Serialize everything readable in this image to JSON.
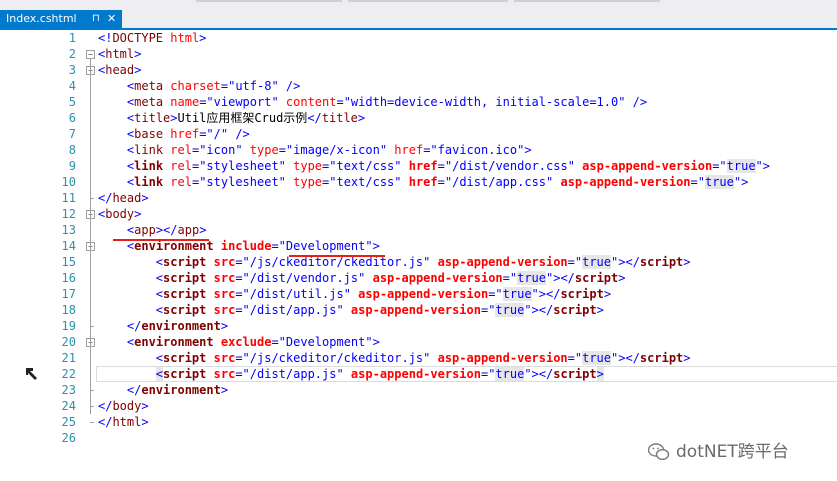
{
  "tab": {
    "title": "Index.cshtml",
    "pin": "⊓",
    "close": "✕"
  },
  "lines": [
    {
      "n": "1",
      "segs": [
        [
          "p",
          "<!"
        ],
        [
          "t",
          "DOCTYPE"
        ],
        [
          "c",
          " "
        ],
        [
          "a",
          "html"
        ],
        [
          "p",
          ">"
        ]
      ]
    },
    {
      "n": "2",
      "segs": [
        [
          "p",
          "<"
        ],
        [
          "t",
          "html"
        ],
        [
          "p",
          ">"
        ]
      ]
    },
    {
      "n": "3",
      "segs": [
        [
          "p",
          "<"
        ],
        [
          "t",
          "head"
        ],
        [
          "p",
          ">"
        ]
      ]
    },
    {
      "n": "4",
      "segs": [
        [
          "c",
          "    "
        ],
        [
          "p",
          "<"
        ],
        [
          "t",
          "meta"
        ],
        [
          "c",
          " "
        ],
        [
          "a",
          "charset"
        ],
        [
          "p",
          "=\""
        ],
        [
          "v",
          "utf-8"
        ],
        [
          "p",
          "\" />"
        ]
      ]
    },
    {
      "n": "5",
      "segs": [
        [
          "c",
          "    "
        ],
        [
          "p",
          "<"
        ],
        [
          "t",
          "meta"
        ],
        [
          "c",
          " "
        ],
        [
          "a",
          "name"
        ],
        [
          "p",
          "=\""
        ],
        [
          "v",
          "viewport"
        ],
        [
          "p",
          "\" "
        ],
        [
          "a",
          "content"
        ],
        [
          "p",
          "=\""
        ],
        [
          "v",
          "width=device-width, initial-scale=1.0"
        ],
        [
          "p",
          "\" />"
        ]
      ]
    },
    {
      "n": "6",
      "segs": [
        [
          "c",
          "    "
        ],
        [
          "p",
          "<"
        ],
        [
          "t",
          "title"
        ],
        [
          "p",
          ">"
        ],
        [
          "c",
          "Util应用框架Crud示例"
        ],
        [
          "p",
          "</"
        ],
        [
          "t",
          "title"
        ],
        [
          "p",
          ">"
        ]
      ]
    },
    {
      "n": "7",
      "segs": [
        [
          "c",
          "    "
        ],
        [
          "p",
          "<"
        ],
        [
          "t",
          "base"
        ],
        [
          "c",
          " "
        ],
        [
          "a",
          "href"
        ],
        [
          "p",
          "=\""
        ],
        [
          "v",
          "/"
        ],
        [
          "p",
          "\" />"
        ]
      ]
    },
    {
      "n": "8",
      "segs": [
        [
          "c",
          "    "
        ],
        [
          "p",
          "<"
        ],
        [
          "t",
          "link"
        ],
        [
          "c",
          " "
        ],
        [
          "a",
          "rel"
        ],
        [
          "p",
          "=\""
        ],
        [
          "v",
          "icon"
        ],
        [
          "p",
          "\" "
        ],
        [
          "a",
          "type"
        ],
        [
          "p",
          "=\""
        ],
        [
          "v",
          "image/x-icon"
        ],
        [
          "p",
          "\" "
        ],
        [
          "a",
          "href"
        ],
        [
          "p",
          "=\""
        ],
        [
          "v",
          "favicon.ico"
        ],
        [
          "p",
          "\">"
        ]
      ]
    },
    {
      "n": "9",
      "segs": [
        [
          "c",
          "    "
        ],
        [
          "p",
          "<"
        ],
        [
          "tb",
          "link"
        ],
        [
          "c",
          " "
        ],
        [
          "a",
          "rel"
        ],
        [
          "p",
          "=\""
        ],
        [
          "v",
          "stylesheet"
        ],
        [
          "p",
          "\" "
        ],
        [
          "a",
          "type"
        ],
        [
          "p",
          "=\""
        ],
        [
          "v",
          "text/css"
        ],
        [
          "p",
          "\" "
        ],
        [
          "ab",
          "href"
        ],
        [
          "p",
          "=\""
        ],
        [
          "v",
          "/dist/vendor.css"
        ],
        [
          "p",
          "\" "
        ],
        [
          "ab",
          "asp-append-version"
        ],
        [
          "p",
          "=\""
        ],
        [
          "vh",
          "true"
        ],
        [
          "p",
          "\">"
        ]
      ]
    },
    {
      "n": "10",
      "segs": [
        [
          "c",
          "    "
        ],
        [
          "p",
          "<"
        ],
        [
          "tb",
          "link"
        ],
        [
          "c",
          " "
        ],
        [
          "a",
          "rel"
        ],
        [
          "p",
          "=\""
        ],
        [
          "v",
          "stylesheet"
        ],
        [
          "p",
          "\" "
        ],
        [
          "a",
          "type"
        ],
        [
          "p",
          "=\""
        ],
        [
          "v",
          "text/css"
        ],
        [
          "p",
          "\" "
        ],
        [
          "ab",
          "href"
        ],
        [
          "p",
          "=\""
        ],
        [
          "v",
          "/dist/app.css"
        ],
        [
          "p",
          "\" "
        ],
        [
          "ab",
          "asp-append-version"
        ],
        [
          "p",
          "=\""
        ],
        [
          "vh",
          "true"
        ],
        [
          "p",
          "\">"
        ]
      ]
    },
    {
      "n": "11",
      "segs": [
        [
          "p",
          "</"
        ],
        [
          "t",
          "head"
        ],
        [
          "p",
          ">"
        ]
      ]
    },
    {
      "n": "12",
      "segs": [
        [
          "p",
          "<"
        ],
        [
          "t",
          "body"
        ],
        [
          "p",
          ">"
        ]
      ]
    },
    {
      "n": "13",
      "segs": [
        [
          "c",
          "    "
        ],
        [
          "p",
          "<"
        ],
        [
          "t",
          "app"
        ],
        [
          "p",
          "></"
        ],
        [
          "t",
          "app"
        ],
        [
          "p",
          ">"
        ]
      ]
    },
    {
      "n": "14",
      "segs": [
        [
          "c",
          "    "
        ],
        [
          "p",
          "<"
        ],
        [
          "tb",
          "environment"
        ],
        [
          "c",
          " "
        ],
        [
          "ab",
          "include"
        ],
        [
          "p",
          "=\""
        ],
        [
          "v",
          "Development"
        ],
        [
          "p",
          "\">"
        ]
      ]
    },
    {
      "n": "15",
      "segs": [
        [
          "c",
          "        "
        ],
        [
          "p",
          "<"
        ],
        [
          "tb",
          "script"
        ],
        [
          "c",
          " "
        ],
        [
          "ab",
          "src"
        ],
        [
          "p",
          "=\""
        ],
        [
          "v",
          "/js/ckeditor/ckeditor.js"
        ],
        [
          "p",
          "\" "
        ],
        [
          "ab",
          "asp-append-version"
        ],
        [
          "p",
          "=\""
        ],
        [
          "vh",
          "true"
        ],
        [
          "p",
          "\"></"
        ],
        [
          "tb",
          "script"
        ],
        [
          "p",
          ">"
        ]
      ]
    },
    {
      "n": "16",
      "segs": [
        [
          "c",
          "        "
        ],
        [
          "p",
          "<"
        ],
        [
          "tb",
          "script"
        ],
        [
          "c",
          " "
        ],
        [
          "ab",
          "src"
        ],
        [
          "p",
          "=\""
        ],
        [
          "v",
          "/dist/vendor.js"
        ],
        [
          "p",
          "\" "
        ],
        [
          "ab",
          "asp-append-version"
        ],
        [
          "p",
          "=\""
        ],
        [
          "vh",
          "true"
        ],
        [
          "p",
          "\"></"
        ],
        [
          "tb",
          "script"
        ],
        [
          "p",
          ">"
        ]
      ]
    },
    {
      "n": "17",
      "segs": [
        [
          "c",
          "        "
        ],
        [
          "p",
          "<"
        ],
        [
          "tb",
          "script"
        ],
        [
          "c",
          " "
        ],
        [
          "ab",
          "src"
        ],
        [
          "p",
          "=\""
        ],
        [
          "v",
          "/dist/util.js"
        ],
        [
          "p",
          "\" "
        ],
        [
          "ab",
          "asp-append-version"
        ],
        [
          "p",
          "=\""
        ],
        [
          "vh",
          "true"
        ],
        [
          "p",
          "\"></"
        ],
        [
          "tb",
          "script"
        ],
        [
          "p",
          ">"
        ]
      ]
    },
    {
      "n": "18",
      "segs": [
        [
          "c",
          "        "
        ],
        [
          "p",
          "<"
        ],
        [
          "tb",
          "script"
        ],
        [
          "c",
          " "
        ],
        [
          "ab",
          "src"
        ],
        [
          "p",
          "=\""
        ],
        [
          "v",
          "/dist/app.js"
        ],
        [
          "p",
          "\" "
        ],
        [
          "ab",
          "asp-append-version"
        ],
        [
          "p",
          "=\""
        ],
        [
          "vh",
          "true"
        ],
        [
          "p",
          "\"></"
        ],
        [
          "tb",
          "script"
        ],
        [
          "p",
          ">"
        ]
      ]
    },
    {
      "n": "19",
      "segs": [
        [
          "c",
          "    "
        ],
        [
          "p",
          "</"
        ],
        [
          "tb",
          "environment"
        ],
        [
          "p",
          ">"
        ]
      ]
    },
    {
      "n": "20",
      "segs": [
        [
          "c",
          "    "
        ],
        [
          "p",
          "<"
        ],
        [
          "tb",
          "environment"
        ],
        [
          "c",
          " "
        ],
        [
          "ab",
          "exclude"
        ],
        [
          "p",
          "=\""
        ],
        [
          "v",
          "Development"
        ],
        [
          "p",
          "\">"
        ]
      ]
    },
    {
      "n": "21",
      "segs": [
        [
          "c",
          "        "
        ],
        [
          "p",
          "<"
        ],
        [
          "tb",
          "script"
        ],
        [
          "c",
          " "
        ],
        [
          "ab",
          "src"
        ],
        [
          "p",
          "=\""
        ],
        [
          "v",
          "/js/ckeditor/ckeditor.js"
        ],
        [
          "p",
          "\" "
        ],
        [
          "ab",
          "asp-append-version"
        ],
        [
          "p",
          "=\""
        ],
        [
          "vh",
          "true"
        ],
        [
          "p",
          "\"></"
        ],
        [
          "tb",
          "script"
        ],
        [
          "p",
          ">"
        ]
      ]
    },
    {
      "n": "22",
      "segs": [
        [
          "c",
          "        "
        ],
        [
          "ph",
          "<"
        ],
        [
          "tb",
          "script"
        ],
        [
          "c",
          " "
        ],
        [
          "ab",
          "src"
        ],
        [
          "p",
          "=\""
        ],
        [
          "v",
          "/dist/app.js"
        ],
        [
          "p",
          "\" "
        ],
        [
          "ab",
          "asp-append-version"
        ],
        [
          "p",
          "=\""
        ],
        [
          "vh",
          "true"
        ],
        [
          "p",
          "\"></"
        ],
        [
          "tb",
          "script"
        ],
        [
          "ph",
          ">"
        ]
      ]
    },
    {
      "n": "23",
      "segs": [
        [
          "c",
          "    "
        ],
        [
          "p",
          "</"
        ],
        [
          "tb",
          "environment"
        ],
        [
          "p",
          ">"
        ]
      ]
    },
    {
      "n": "24",
      "segs": [
        [
          "p",
          "</"
        ],
        [
          "t",
          "body"
        ],
        [
          "p",
          ">"
        ]
      ]
    },
    {
      "n": "25",
      "segs": [
        [
          "p",
          "</"
        ],
        [
          "t",
          "html"
        ],
        [
          "p",
          ">"
        ]
      ]
    },
    {
      "n": "26",
      "segs": []
    }
  ],
  "folds": [
    "2",
    "3",
    "12",
    "14",
    "20"
  ],
  "current_line": "22",
  "margin_icon": "hammer-icon",
  "watermark": {
    "text": "dotNET跨平台",
    "icon": "wechat-icon"
  },
  "colors": {
    "tag": "#800000",
    "punct": "#0000ff",
    "attr": "#ff0000",
    "value": "#0000ff",
    "accent": "#007acc",
    "line_number": "#2b91af",
    "underline": "#e8201a"
  }
}
